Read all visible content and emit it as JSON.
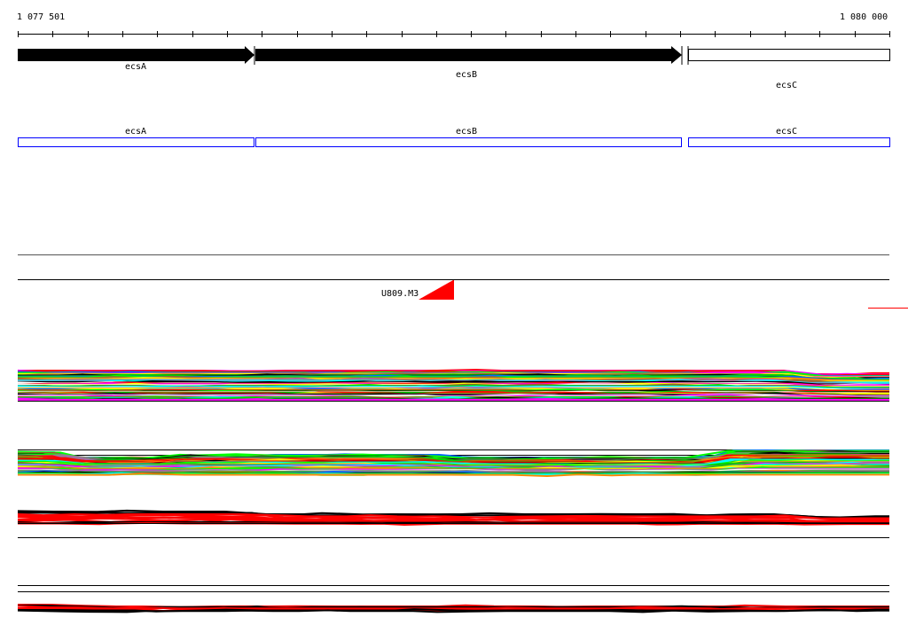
{
  "ruler": {
    "start_label": "1 077 501",
    "end_label": "1 080 000",
    "tick_count": 25
  },
  "genes": [
    {
      "name": "ecsA",
      "strand": "+",
      "filled": true
    },
    {
      "name": "ecsB",
      "strand": "+",
      "filled": true
    },
    {
      "name": "ecsC",
      "strand": "+",
      "filled": false
    }
  ],
  "annotation_track": {
    "labels": [
      "ecsA",
      "ecsB",
      "ecsC"
    ],
    "color": "#0000ff"
  },
  "feature": {
    "label": "U809.M3",
    "color": "#ff0000"
  },
  "colors": {
    "palette": [
      "#ff00ff",
      "#00ff00",
      "#0066ff",
      "#ff8800",
      "#00ffff",
      "#888888",
      "#ffff00",
      "#000000",
      "#ff0000",
      "#aa66aa",
      "#996633",
      "#00cc00",
      "#ffffff"
    ],
    "red": "#ff0000",
    "black": "#000000"
  }
}
